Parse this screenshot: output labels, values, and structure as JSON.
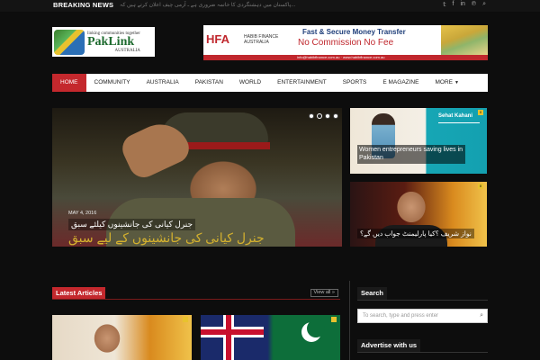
{
  "topbar": {
    "breaking_label": "BREAKING NEWS",
    "ticker": "پاکستان میں دہشتگردی کا خاتمہ ضروری ہے ـ آرمی چیف اعلان کرتے ہیں کہ...",
    "social_icons": [
      "twitter-icon",
      "facebook-icon",
      "linkedin-icon",
      "pinterest-icon",
      "search-icon"
    ]
  },
  "logo": {
    "tagline": "linking communities together",
    "name": "PakLink",
    "subtitle": "AUSTRALIA"
  },
  "ad": {
    "brand": "HFA",
    "brand_name": "HABIB FINANCE",
    "brand_country": "AUSTRALIA",
    "line1": "Fast & Secure Money Transfer",
    "line2": "No Commission No Fee",
    "contact": "info@habibfinance.com.au  ·  www.habibfinance.com.au"
  },
  "nav": {
    "items": [
      "HOME",
      "COMMUNITY",
      "AUSTRALIA",
      "PAKISTAN",
      "WORLD",
      "ENTERTAINMENT",
      "SPORTS",
      "E MAGAZINE",
      "MORE"
    ],
    "active": "HOME"
  },
  "hero": {
    "date": "MAY 4, 2016",
    "title": "جنرل کیانی کی جانشینوں کیلئے سبق",
    "overlay": "جنرل کیانی کی جانشینوں کے لیے سبق",
    "slides": 4,
    "active_slide": 2
  },
  "side_cards": [
    {
      "title": "Women entrepreneurs saving lives in Pakistan",
      "badge": "0",
      "banner": "Sehat Kahani"
    },
    {
      "title": "نواز شریف ؟کیا پارلیمنٹ جواب دیں گے؟",
      "badge": "0"
    }
  ],
  "latest": {
    "label": "Latest Articles",
    "view_all": "View all »"
  },
  "sidebar": {
    "search_title": "Search",
    "search_placeholder": "To search, type and press enter",
    "advertise_title": "Advertise with us"
  }
}
